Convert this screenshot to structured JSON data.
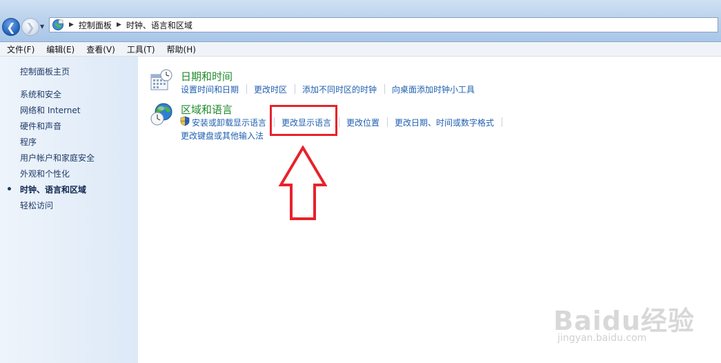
{
  "nav": {
    "back_glyph": "❮",
    "forward_glyph": "❯",
    "dropdown_glyph": "▼"
  },
  "address": {
    "icon": "control-panel-icon",
    "crumbs": [
      "控制面板",
      "时钟、语言和区域"
    ]
  },
  "menubar": {
    "items": [
      "文件(F)",
      "编辑(E)",
      "查看(V)",
      "工具(T)",
      "帮助(H)"
    ]
  },
  "sidebar": {
    "home": "控制面板主页",
    "items": [
      "系统和安全",
      "网络和 Internet",
      "硬件和声音",
      "程序",
      "用户帐户和家庭安全",
      "外观和个性化",
      "时钟、语言和区域",
      "轻松访问"
    ],
    "active_index": 6
  },
  "categories": {
    "datetime": {
      "title": "日期和时间",
      "icon": "calendar-clock-icon",
      "links": [
        "设置时间和日期",
        "更改时区",
        "添加不同时区的时钟",
        "向桌面添加时钟小工具"
      ]
    },
    "region": {
      "title": "区域和语言",
      "icon": "globe-clock-icon",
      "links": [
        "安装或卸载显示语言",
        "更改显示语言",
        "更改位置",
        "更改日期、时间或数字格式",
        "更改键盘或其他输入法"
      ],
      "shield_icon": "uac-shield-icon"
    }
  },
  "annotation": {
    "highlight_color": "#e8222a",
    "highlighted_link": "更改显示语言"
  },
  "watermark": {
    "logo": "Baidu经验",
    "url": "jingyan.baidu.com"
  },
  "colors": {
    "category_title": "#1e8a2a",
    "link": "#1f5fb0",
    "sidebar_text": "#1f3b68"
  }
}
